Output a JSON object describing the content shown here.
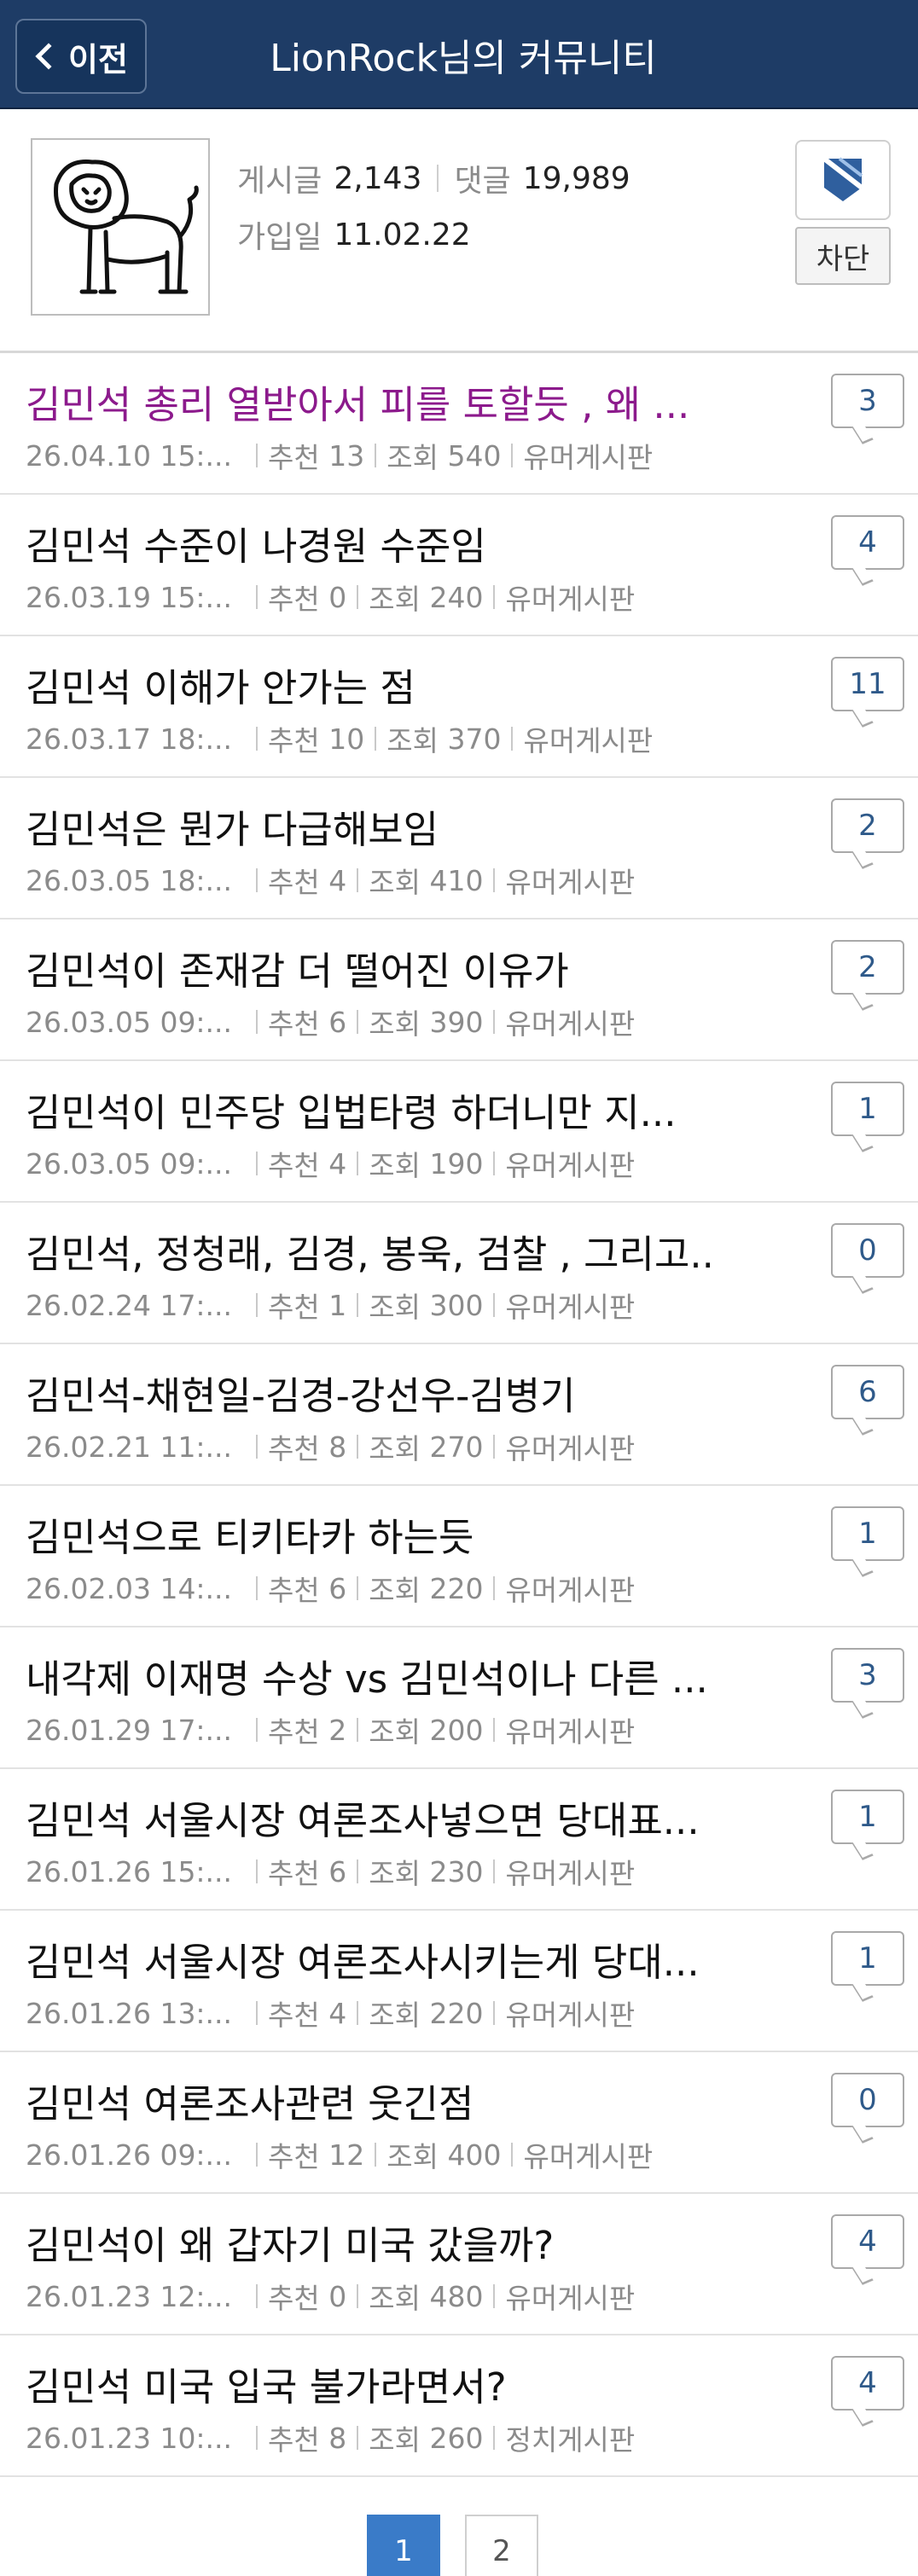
{
  "header": {
    "back_label": "이전",
    "title": "LionRock님의 커뮤니티"
  },
  "profile": {
    "posts_label": "게시글",
    "posts_value": "2,143",
    "comments_label": "댓글",
    "comments_value": "19,989",
    "joined_label": "가입일",
    "joined_value": "11.02.22",
    "block_label": "차단"
  },
  "meta_labels": {
    "recommend": "추천",
    "views": "조회"
  },
  "posts": [
    {
      "title": "김민석 총리 열받아서 피를 토할듯 , 왜 ...",
      "date": "26.04.10  15:...",
      "rec": "13",
      "views": "540",
      "board": "유머게시판",
      "comments": "3"
    },
    {
      "title": "김민석 수준이 나경원 수준임",
      "date": "26.03.19  15:...",
      "rec": "0",
      "views": "240",
      "board": "유머게시판",
      "comments": "4"
    },
    {
      "title": "김민석 이해가 안가는 점",
      "date": "26.03.17  18:...",
      "rec": "10",
      "views": "370",
      "board": "유머게시판",
      "comments": "11"
    },
    {
      "title": "김민석은 뭔가 다급해보임",
      "date": "26.03.05  18:...",
      "rec": "4",
      "views": "410",
      "board": "유머게시판",
      "comments": "2"
    },
    {
      "title": "김민석이 존재감 더 떨어진 이유가",
      "date": "26.03.05  09:...",
      "rec": "6",
      "views": "390",
      "board": "유머게시판",
      "comments": "2"
    },
    {
      "title": "김민석이 민주당 입법타령 하더니만 지...",
      "date": "26.03.05  09:...",
      "rec": "4",
      "views": "190",
      "board": "유머게시판",
      "comments": "1"
    },
    {
      "title": "김민석, 정청래, 김경, 봉욱, 검찰 , 그리고...",
      "date": "26.02.24  17:...",
      "rec": "1",
      "views": "300",
      "board": "유머게시판",
      "comments": "0"
    },
    {
      "title": "김민석-채현일-김경-강선우-김병기",
      "date": "26.02.21  11:...",
      "rec": "8",
      "views": "270",
      "board": "유머게시판",
      "comments": "6"
    },
    {
      "title": "김민석으로 티키타카 하는듯",
      "date": "26.02.03  14:...",
      "rec": "6",
      "views": "220",
      "board": "유머게시판",
      "comments": "1"
    },
    {
      "title": "내각제 이재명 수상 vs 김민석이나 다른 ...",
      "date": "26.01.29  17:...",
      "rec": "2",
      "views": "200",
      "board": "유머게시판",
      "comments": "3"
    },
    {
      "title": "김민석 서울시장 여론조사넣으면 당대표...",
      "date": "26.01.26  15:...",
      "rec": "6",
      "views": "230",
      "board": "유머게시판",
      "comments": "1"
    },
    {
      "title": "김민석 서울시장 여론조사시키는게 당대...",
      "date": "26.01.26  13:...",
      "rec": "4",
      "views": "220",
      "board": "유머게시판",
      "comments": "1"
    },
    {
      "title": "김민석 여론조사관련 웃긴점",
      "date": "26.01.26  09:...",
      "rec": "12",
      "views": "400",
      "board": "유머게시판",
      "comments": "0"
    },
    {
      "title": "김민석이 왜 갑자기 미국 갔을까?",
      "date": "26.01.23  12:...",
      "rec": "0",
      "views": "480",
      "board": "유머게시판",
      "comments": "4"
    },
    {
      "title": "김민석 미국 입국 불가라면서?",
      "date": "26.01.23  10:...",
      "rec": "8",
      "views": "260",
      "board": "정치게시판",
      "comments": "4"
    }
  ],
  "pagination": {
    "pages": [
      "1",
      "2"
    ],
    "active": "1"
  },
  "colors": {
    "header_bg": "#1e3c66",
    "visited_title": "#8c1a8c",
    "active_page": "#3a7bc8"
  }
}
